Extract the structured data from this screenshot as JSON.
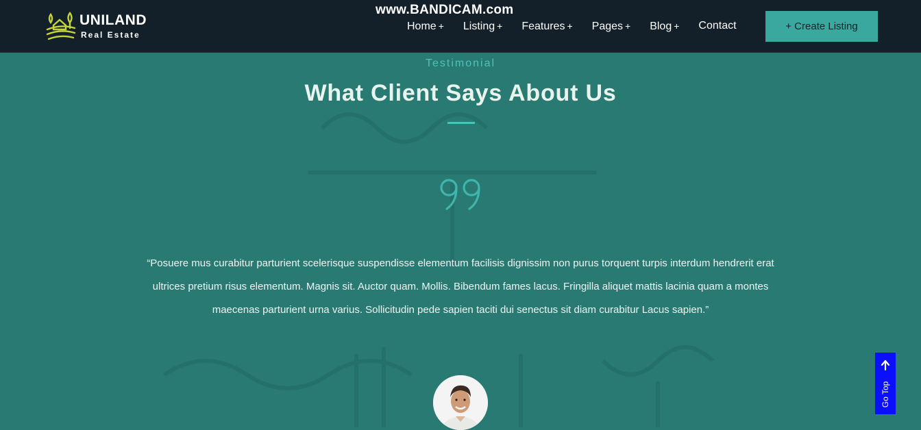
{
  "brand": {
    "name": "UNILAND",
    "tagline": "Real Estate"
  },
  "watermark": "www.BANDICAM.com",
  "nav": {
    "items": [
      {
        "label": "Home",
        "suffix": "+"
      },
      {
        "label": "Listing",
        "suffix": "+"
      },
      {
        "label": "Features",
        "suffix": "+"
      },
      {
        "label": "Pages",
        "suffix": "+"
      },
      {
        "label": "Blog",
        "suffix": "+"
      },
      {
        "label": "Contact",
        "suffix": ""
      }
    ],
    "cta_label": "+ Create Listing"
  },
  "testimonial": {
    "eyebrow": "Testimonial",
    "heading": "What Client Says About Us",
    "quote_icon": "quote-icon",
    "quote": "“Posuere mus curabitur parturient scelerisque suspendisse elementum facilisis dignissim non purus torquent turpis interdum hendrerit erat ultrices pretium risus elementum. Magnis sit. Auctor quam. Mollis. Bibendum fames lacus. Fringilla aliquet mattis lacinia quam a montes maecenas parturient urna varius. Sollicitudin pede sapien taciti dui senectus sit diam curabitur Lacus sapien.”"
  },
  "go_top": {
    "label": "Go Top",
    "icon": "arrow-up-icon"
  },
  "colors": {
    "navbar": "#13202a",
    "section": "#2a7a74",
    "accent": "#3aa89e",
    "go_top": "#0a10ff"
  }
}
